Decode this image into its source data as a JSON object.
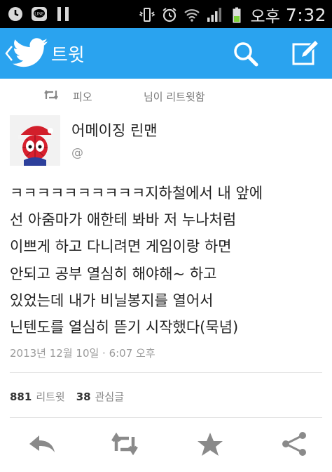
{
  "status_bar": {
    "icons": [
      "clock-icon",
      "line-app-icon",
      "pause-icon",
      "vibrate-icon",
      "alarm-icon",
      "wifi-icon",
      "signal-icon",
      "battery-icon"
    ],
    "ampm": "오후",
    "time": "7:32"
  },
  "app_bar": {
    "title": "트윗",
    "color": "#2aa3ef",
    "icons": [
      "back-chevron-icon",
      "twitter-bird-icon",
      "search-icon",
      "compose-icon"
    ]
  },
  "retweet": {
    "user": "피오",
    "suffix": "님이 리트윗함",
    "icon": "retweet-icon"
  },
  "tweet": {
    "display_name": "어메이징 린맨",
    "handle": "@",
    "lines": [
      "ㅋㅋㅋㅋㅋㅋㅋㅋㅋㅋ지하철에서 내 앞에",
      "선 아줌마가 애한테 봐바 저 누나처럼",
      "이쁘게 하고 다니려면 게임이랑 하면",
      "안되고 공부 열심히 해야해~ 하고",
      "있었는데 내가 비닐봉지를 열어서",
      "닌텐도를 열심히 뜯기 시작했다(묵념)"
    ],
    "timestamp": "2013년 12월 10일 · 6:07 오후"
  },
  "stats": {
    "retweets_count": "881",
    "retweets_label": "리트윗",
    "favorites_count": "38",
    "favorites_label": "관심글"
  },
  "actions": [
    "reply-icon",
    "retweet-icon",
    "favorite-star-icon",
    "share-icon"
  ]
}
